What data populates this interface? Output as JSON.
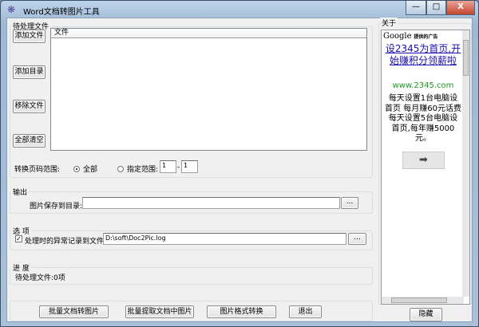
{
  "window": {
    "title": "Word文档转图片工具",
    "controls": {
      "minimize": "—",
      "maximize": "□",
      "close": "X"
    }
  },
  "pending": {
    "group_label": "待处理文件",
    "buttons": {
      "add_file": "添加文件",
      "add_dir": "添加目录",
      "remove_file": "移除文件",
      "clear_all": "全部清空"
    },
    "list_header": "文件",
    "files": []
  },
  "range": {
    "label": "转换页码范围:",
    "all": "全部",
    "specified": "指定范围:",
    "from": "1",
    "to": "1",
    "selected": "all",
    "dash": "-"
  },
  "output": {
    "group_label": "输出",
    "save_dir_label": "图片保存到目录:",
    "save_dir_value": "",
    "browse": "..."
  },
  "options": {
    "group_label": "选 项",
    "log_label": "处理时的异常记录到文件:",
    "log_checked": true,
    "log_path": "D:\\soft\\Doc2Pic.log",
    "browse": "..."
  },
  "progress": {
    "group_label": "进 度",
    "status": "待处理文件:0项"
  },
  "actions": {
    "batch_convert": "批量文档转图片",
    "batch_extract": "批量提取文档中图片",
    "format_convert": "图片格式转换",
    "exit": "退出"
  },
  "about": {
    "group_label": "关于",
    "ad_provider": "Google",
    "ad_provider_suffix": "提供的广告",
    "ad_headline": "设2345为首页,开始赚积分领薪啦",
    "ad_url": "www.2345.com",
    "ad_body": "每天设置1台电脑设首页 每月赚60元话费 每天设置5台电脑设首页,每年赚5000元。",
    "ad_arrow": "➡",
    "hide": "隐藏",
    "link_color": "#1a0dab",
    "url_color": "#1e9a1e"
  }
}
